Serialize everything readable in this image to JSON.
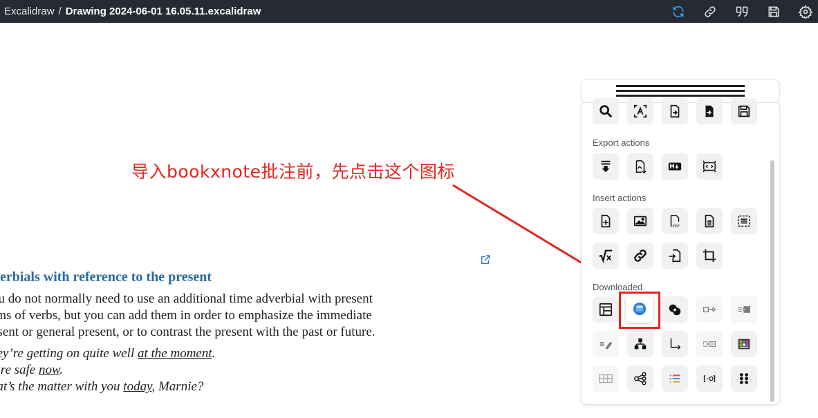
{
  "header": {
    "app_name": "Excalidraw",
    "separator": "/",
    "file_name": "Drawing 2024-06-01 16.05.11.excalidraw",
    "icons": [
      "sync-icon",
      "link-icon",
      "quote-icon",
      "save-icon",
      "settings-icon"
    ],
    "accent": "#3b9ee6",
    "background": "#262b33"
  },
  "annotation": {
    "text": "导入bookxnote批注前，先点击这个图标",
    "color": "#e3241f"
  },
  "document": {
    "heading": "verbials with reference to the present",
    "paragraph_lines": [
      "ou do not normally need to use an additional time adverbial with present",
      "rms of verbs, but you can add them in order to emphasize the immediate",
      "esent or general present, or to contrast the present with the past or future."
    ],
    "examples": [
      {
        "before": "ney’re getting on quite well ",
        "underlined": "at the moment",
        "after": "."
      },
      {
        "before": "e’re safe ",
        "underlined": "now",
        "after": "."
      },
      {
        "before": "hat’s the matter with you ",
        "underlined": "today",
        "after": ", Marnie?"
      }
    ],
    "heading_color": "#2a6aa0"
  },
  "panel": {
    "sections": {
      "export": "Export actions",
      "insert": "Insert actions",
      "downloaded": "Downloaded"
    },
    "top_row": [
      "search-icon",
      "ocr-icon",
      "open-file-icon",
      "import-file-icon",
      "save-disk-icon"
    ],
    "export_row": [
      "download-icon",
      "export-image-icon",
      "markdown-icon",
      "embed-icon"
    ],
    "insert_row1": [
      "add-file-icon",
      "image-icon",
      "pdf-icon",
      "document-icon",
      "text-block-icon"
    ],
    "insert_row2": [
      "math-sqrt-icon",
      "link-chain-icon",
      "insert-link-file-icon",
      "crop-icon"
    ],
    "downloaded_row1": [
      "layout-icon",
      "bookxnote-icon",
      "connect-shapes-icon",
      "box-link-icon",
      "list-box-icon"
    ],
    "downloaded_row2": [
      "list-pen-icon",
      "tree-icon",
      "elbow-arrow-icon",
      "grouped-box-icon",
      "color-palette-icon"
    ],
    "downloaded_row3": [
      "table-grid-icon",
      "mindmap-icon",
      "colored-list-icon",
      "bracket-icon",
      "dots-grid-icon"
    ],
    "highlight_color": "#e3241f"
  }
}
